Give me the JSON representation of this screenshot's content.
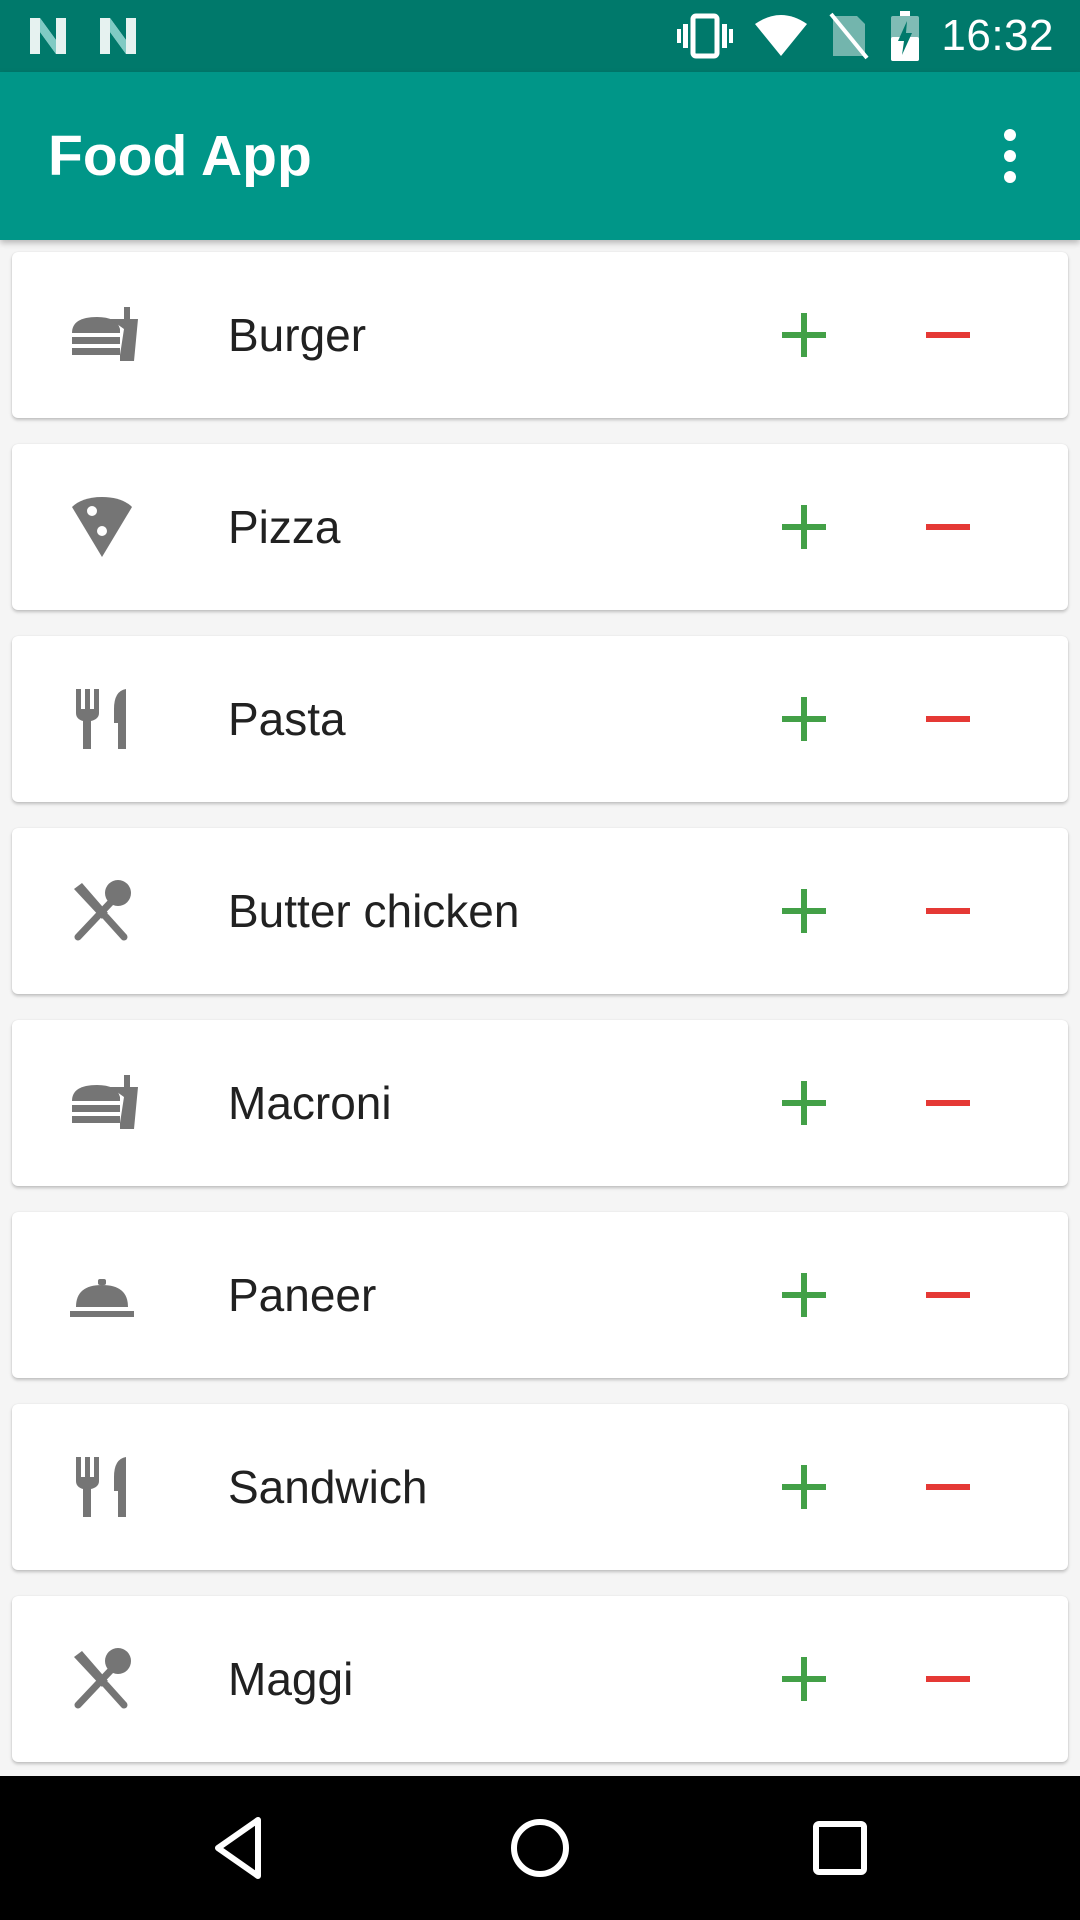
{
  "status_bar": {
    "time": "16:32",
    "left_icons": [
      "n-notification-icon",
      "n-notification-icon"
    ],
    "right_icons": [
      "vibrate-icon",
      "wifi-icon",
      "no-sim-icon",
      "battery-charging-icon"
    ]
  },
  "app_bar": {
    "title": "Food App",
    "menu_icon": "more-vert-icon"
  },
  "colors": {
    "status_bar": "#00796b",
    "app_bar": "#009688",
    "add": "#43a047",
    "remove": "#e53935",
    "icon_gray": "#757575"
  },
  "food_items": [
    {
      "name": "Burger",
      "icon": "fastfood-icon"
    },
    {
      "name": "Pizza",
      "icon": "pizza-icon"
    },
    {
      "name": "Pasta",
      "icon": "restaurant-icon"
    },
    {
      "name": "Butter chicken",
      "icon": "dining-icon"
    },
    {
      "name": "Macroni",
      "icon": "fastfood-icon"
    },
    {
      "name": "Paneer",
      "icon": "room-service-icon"
    },
    {
      "name": "Sandwich",
      "icon": "restaurant-icon"
    },
    {
      "name": "Maggi",
      "icon": "dining-icon"
    }
  ],
  "nav_bar": {
    "buttons": [
      "back-icon",
      "home-icon",
      "recents-icon"
    ]
  }
}
